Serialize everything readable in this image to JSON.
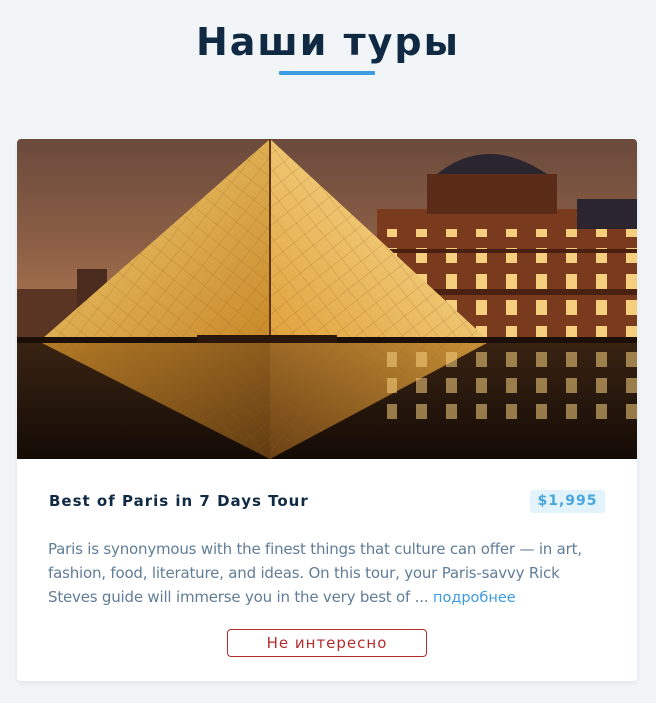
{
  "header": {
    "title": "Наши туры"
  },
  "tour": {
    "name": "Best of Paris in 7 Days Tour",
    "price": "$1,995",
    "description": "Paris is synonymous with the finest things that culture can offer — in art, fashion, food, literature, and ideas. On this tour, your Paris-savvy Rick Steves guide will immerse you in the very best of ...",
    "read_more_label": "подробнее",
    "not_interested_label": "Не интересно",
    "image_subject": "Louvre pyramid at night"
  },
  "colors": {
    "background": "#f1f5f8",
    "title": "#102a43",
    "accent": "#3d9be2",
    "price_background": "#e2f3fc",
    "description_text": "#617d98",
    "danger": "#b32d2d"
  }
}
